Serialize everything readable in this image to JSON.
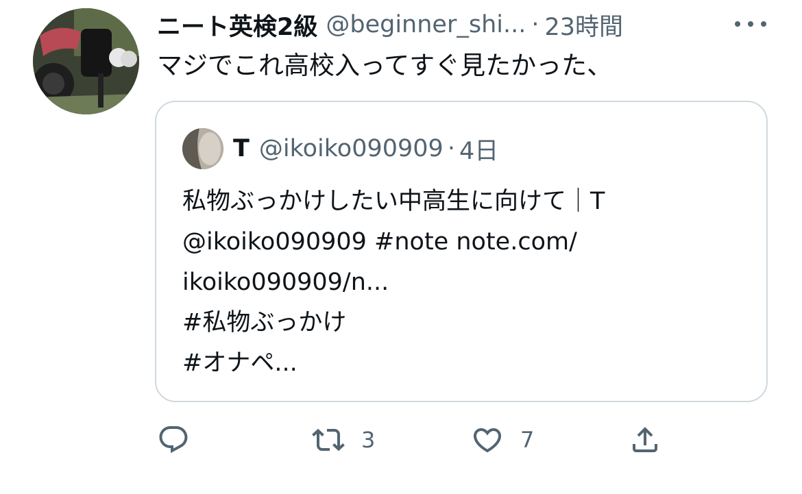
{
  "tweet": {
    "display_name": "ニート英検2級",
    "handle": "@beginner_shi...",
    "separator": "·",
    "time": "23時間",
    "text": "マジでこれ高校入ってすぐ見たかった、"
  },
  "quoted": {
    "display_name": "T",
    "handle": "@ikoiko090909",
    "separator": "·",
    "time": "4日",
    "lines": [
      "私物ぶっかけしたい中高生に向けて｜T",
      "@ikoiko090909 #note note.com/",
      "ikoiko090909/n...",
      "#私物ぶっかけ",
      "#オナペ..."
    ]
  },
  "actions": {
    "reply_icon": "reply-icon",
    "retweet_icon": "retweet-icon",
    "retweet_count": "3",
    "like_icon": "heart-icon",
    "like_count": "7",
    "share_icon": "share-icon"
  },
  "colors": {
    "primary_text": "#0f1419",
    "secondary_text": "#536471",
    "border": "#cfd9de"
  }
}
